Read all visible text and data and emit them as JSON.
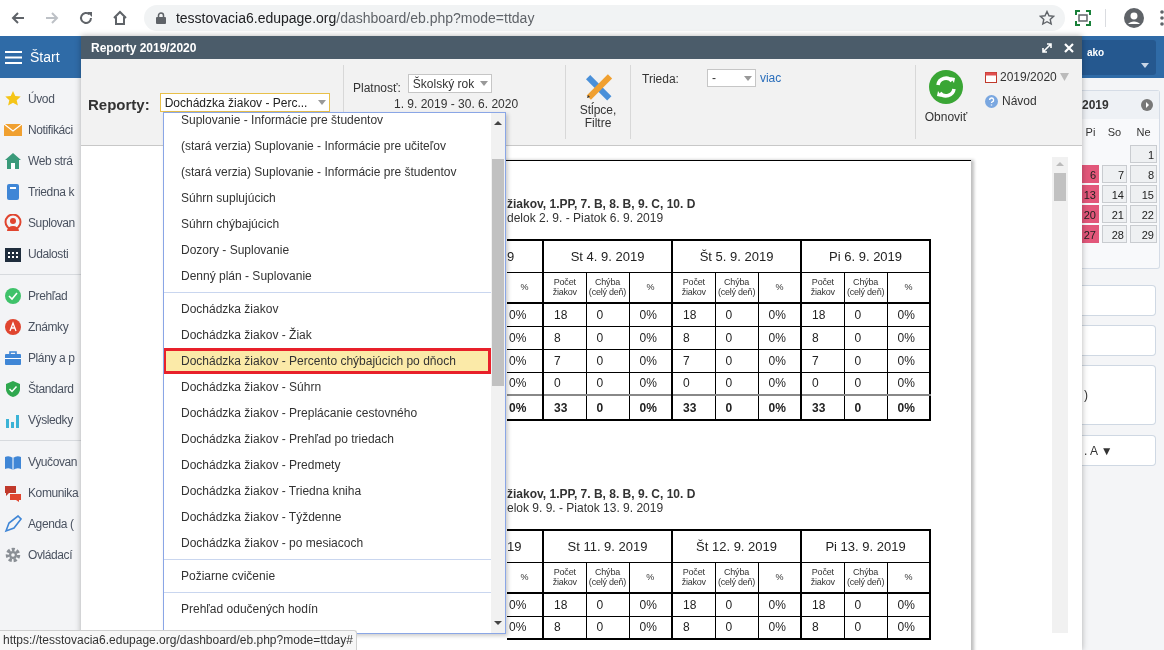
{
  "browser": {
    "url_host": "tesstovacia6.edupage.org",
    "url_path": "/dashboard/eb.php?mode=ttday",
    "forward_disabled": true
  },
  "sidebar": {
    "header": "Štart",
    "groups": [
      [
        {
          "label": "Úvod"
        },
        {
          "label": "Notifikáci"
        },
        {
          "label": "Web strá"
        },
        {
          "label": "Triedna k"
        },
        {
          "label": "Suplovan"
        },
        {
          "label": "Udalosti"
        }
      ],
      [
        {
          "label": "Prehľad"
        },
        {
          "label": "Známky"
        },
        {
          "label": "Plány a p"
        },
        {
          "label": "Štandard"
        },
        {
          "label": "Výsledky"
        }
      ],
      [
        {
          "label": "Vyučovan"
        },
        {
          "label": "Komunika"
        },
        {
          "label": "Agenda ("
        },
        {
          "label": "Ovládací"
        }
      ]
    ]
  },
  "user_panel": {
    "label": "ako"
  },
  "calendar": {
    "title": "2019",
    "weekdays": [
      "Pi",
      "So",
      "Ne"
    ],
    "weeks": [
      [
        {
          "kind": "blank"
        },
        {
          "kind": "blank"
        },
        {
          "kind": "day",
          "day": "1",
          "highlighted": false
        }
      ],
      [
        {
          "kind": "day",
          "day": "6",
          "highlighted": true
        },
        {
          "kind": "day",
          "day": "7",
          "highlighted": false
        },
        {
          "kind": "day",
          "day": "8",
          "highlighted": false
        }
      ],
      [
        {
          "kind": "day",
          "day": "13",
          "highlighted": true
        },
        {
          "kind": "day",
          "day": "14",
          "highlighted": false
        },
        {
          "kind": "day",
          "day": "15",
          "highlighted": false
        }
      ],
      [
        {
          "kind": "day",
          "day": "20",
          "highlighted": true
        },
        {
          "kind": "day",
          "day": "21",
          "highlighted": false
        },
        {
          "kind": "day",
          "day": "22",
          "highlighted": false
        }
      ],
      [
        {
          "kind": "day",
          "day": "27",
          "highlighted": true
        },
        {
          "kind": "day",
          "day": "28",
          "highlighted": false
        },
        {
          "kind": "day",
          "day": "29",
          "highlighted": false
        }
      ]
    ]
  },
  "side_boxes": [
    {
      "kind": "empty"
    },
    {
      "kind": "empty"
    },
    {
      "kind": "tall",
      "text": ")"
    },
    {
      "kind": "text",
      "text": ". A ▼"
    }
  ],
  "dialog": {
    "title": "Reporty 2019/2020",
    "toolbar": {
      "report_label": "Reporty:",
      "report_value": "Dochádzka žiakov - Perc...",
      "validity_label": "Platnosť:",
      "validity_value": "Školský rok",
      "validity_range": "1. 9. 2019 - 30. 6. 2020",
      "columns_button": "Stĺpce, Filtre",
      "class_label": "Trieda:",
      "class_value": "-",
      "more_link": "viac",
      "refresh_button": "Obnoviť",
      "year_value": "2019/2020",
      "help_link": "Návod"
    }
  },
  "report": {
    "weeks": [
      {
        "title": "žiakov, 1.PP, 7. B, 8. B, 9. C, 10. D",
        "subtitle": "delok 2. 9. - Piatok 6. 9. 2019",
        "first_header": "9",
        "days": [
          "St 4. 9. 2019",
          "Št 5. 9. 2019",
          "Pi 6. 9. 2019"
        ],
        "columns": [
          "%",
          "Počet žiakov",
          "Chýba (celý deň)",
          "%",
          "Počet žiakov",
          "Chýba (celý deň)",
          "%",
          "Počet žiakov",
          "Chýba (celý deň)",
          "%"
        ],
        "rows": [
          {
            "total": false,
            "cells": [
              "0%",
              "18",
              "0",
              "0%",
              "18",
              "0",
              "0%",
              "18",
              "0",
              "0%"
            ]
          },
          {
            "total": false,
            "cells": [
              "0%",
              "8",
              "0",
              "0%",
              "8",
              "0",
              "0%",
              "8",
              "0",
              "0%"
            ]
          },
          {
            "total": false,
            "cells": [
              "0%",
              "7",
              "0",
              "0%",
              "7",
              "0",
              "0%",
              "7",
              "0",
              "0%"
            ]
          },
          {
            "total": false,
            "cells": [
              "0%",
              "0",
              "0",
              "0%",
              "0",
              "0",
              "0%",
              "0",
              "0",
              "0%"
            ]
          },
          {
            "total": true,
            "cells": [
              "0%",
              "33",
              "0",
              "0%",
              "33",
              "0",
              "0%",
              "33",
              "0",
              "0%"
            ]
          }
        ]
      },
      {
        "title": "žiakov, 1.PP, 7. B, 8. B, 9. C, 10. D",
        "subtitle": "elok 9. 9. - Piatok 13. 9. 2019",
        "first_header": "19",
        "days": [
          "St 11. 9. 2019",
          "Št 12. 9. 2019",
          "Pi 13. 9. 2019"
        ],
        "columns": [
          "%",
          "Počet žiakov",
          "Chýba (celý deň)",
          "%",
          "Počet žiakov",
          "Chýba (celý deň)",
          "%",
          "Počet žiakov",
          "Chýba (celý deň)",
          "%"
        ],
        "rows": [
          {
            "total": false,
            "cells": [
              "0%",
              "18",
              "0",
              "0%",
              "18",
              "0",
              "0%",
              "18",
              "0",
              "0%"
            ]
          },
          {
            "total": false,
            "cells": [
              "0%",
              "8",
              "0",
              "0%",
              "8",
              "0",
              "0%",
              "8",
              "0",
              "0%"
            ]
          }
        ]
      }
    ]
  },
  "dropdown": {
    "groups": [
      [
        {
          "label": "Suplovanie - Informácie pre študentov",
          "selected": false,
          "outlined": false
        },
        {
          "label": "(stará verzia) Suplovanie - Informácie pre učiteľov",
          "selected": false,
          "outlined": false
        },
        {
          "label": "(stará verzia) Suplovanie - Informácie pre študentov",
          "selected": false,
          "outlined": false
        },
        {
          "label": "Súhrn suplujúcich",
          "selected": false,
          "outlined": false
        },
        {
          "label": "Súhrn chýbajúcich",
          "selected": false,
          "outlined": false
        },
        {
          "label": "Dozory - Suplovanie",
          "selected": false,
          "outlined": false
        },
        {
          "label": "Denný plán - Suplovanie",
          "selected": false,
          "outlined": false
        }
      ],
      [
        {
          "label": "Dochádzka žiakov",
          "selected": false,
          "outlined": false
        },
        {
          "label": "Dochádzka žiakov - Žiak",
          "selected": false,
          "outlined": false
        },
        {
          "label": "Dochádzka žiakov - Percento chýbajúcich po dňoch",
          "selected": true,
          "outlined": true
        },
        {
          "label": "Dochádzka žiakov - Súhrn",
          "selected": false,
          "outlined": false
        },
        {
          "label": "Dochádzka žiakov - Preplácanie cestovného",
          "selected": false,
          "outlined": false
        },
        {
          "label": "Dochádzka žiakov - Prehľad po triedach",
          "selected": false,
          "outlined": false
        },
        {
          "label": "Dochádzka žiakov - Predmety",
          "selected": false,
          "outlined": false
        },
        {
          "label": "Dochádzka žiakov - Triedna kniha",
          "selected": false,
          "outlined": false
        },
        {
          "label": "Dochádzka žiakov - Týždenne",
          "selected": false,
          "outlined": false
        },
        {
          "label": "Dochádzka žiakov - po mesiacoch",
          "selected": false,
          "outlined": false
        }
      ],
      [
        {
          "label": "Požiarne cvičenie",
          "selected": false,
          "outlined": false
        }
      ],
      [
        {
          "label": "Prehľad odučených hodín",
          "selected": false,
          "outlined": false
        }
      ]
    ]
  },
  "status_url": "https://tesstovacia6.edupage.org/dashboard/eb.php?mode=ttday#"
}
